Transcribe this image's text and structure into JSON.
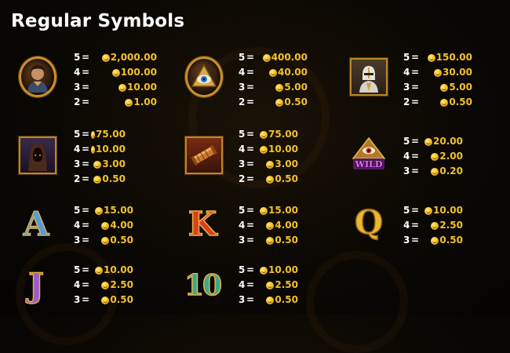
{
  "title": "Regular Symbols",
  "symbols": [
    {
      "icon": "warrior-portrait-icon",
      "pays": [
        {
          "count": "5",
          "value": "2,000.00"
        },
        {
          "count": "4",
          "value": "100.00"
        },
        {
          "count": "3",
          "value": "10.00"
        },
        {
          "count": "2",
          "value": "1.00"
        }
      ]
    },
    {
      "icon": "eye-of-providence-icon",
      "pays": [
        {
          "count": "5",
          "value": "400.00"
        },
        {
          "count": "4",
          "value": "40.00"
        },
        {
          "count": "3",
          "value": "5.00"
        },
        {
          "count": "2",
          "value": "0.50"
        }
      ]
    },
    {
      "icon": "white-knight-icon",
      "pays": [
        {
          "count": "5",
          "value": "150.00"
        },
        {
          "count": "4",
          "value": "30.00"
        },
        {
          "count": "3",
          "value": "5.00"
        },
        {
          "count": "2",
          "value": "0.50"
        }
      ]
    },
    {
      "icon": "hooded-monk-icon",
      "pays": [
        {
          "count": "5",
          "value": "75.00"
        },
        {
          "count": "4",
          "value": "10.00"
        },
        {
          "count": "3",
          "value": "3.00"
        },
        {
          "count": "2",
          "value": "0.50"
        }
      ]
    },
    {
      "icon": "scroll-icon",
      "pays": [
        {
          "count": "5",
          "value": "75.00"
        },
        {
          "count": "4",
          "value": "10.00"
        },
        {
          "count": "3",
          "value": "3.00"
        },
        {
          "count": "2",
          "value": "0.50"
        }
      ]
    },
    {
      "icon": "wild-eye-pyramid-icon",
      "label": "WILD",
      "pays": [
        {
          "count": "5",
          "value": "20.00"
        },
        {
          "count": "4",
          "value": "2.00"
        },
        {
          "count": "3",
          "value": "0.20"
        }
      ]
    },
    {
      "icon": "letter-a-icon",
      "letter": "A",
      "pays": [
        {
          "count": "5",
          "value": "15.00"
        },
        {
          "count": "4",
          "value": "4.00"
        },
        {
          "count": "3",
          "value": "0.50"
        }
      ]
    },
    {
      "icon": "letter-k-icon",
      "letter": "K",
      "pays": [
        {
          "count": "5",
          "value": "15.00"
        },
        {
          "count": "4",
          "value": "4.00"
        },
        {
          "count": "3",
          "value": "0.50"
        }
      ]
    },
    {
      "icon": "letter-q-icon",
      "letter": "Q",
      "pays": [
        {
          "count": "5",
          "value": "10.00"
        },
        {
          "count": "4",
          "value": "2.50"
        },
        {
          "count": "3",
          "value": "0.50"
        }
      ]
    },
    {
      "icon": "letter-j-icon",
      "letter": "J",
      "pays": [
        {
          "count": "5",
          "value": "10.00"
        },
        {
          "count": "4",
          "value": "2.50"
        },
        {
          "count": "3",
          "value": "0.50"
        }
      ]
    },
    {
      "icon": "number-10-icon",
      "letter": "10",
      "pays": [
        {
          "count": "5",
          "value": "10.00"
        },
        {
          "count": "4",
          "value": "2.50"
        },
        {
          "count": "3",
          "value": "0.50"
        }
      ]
    }
  ],
  "colors": {
    "accent": "#f2c12e",
    "text": "#ffffff",
    "frame": "#c8902a"
  }
}
